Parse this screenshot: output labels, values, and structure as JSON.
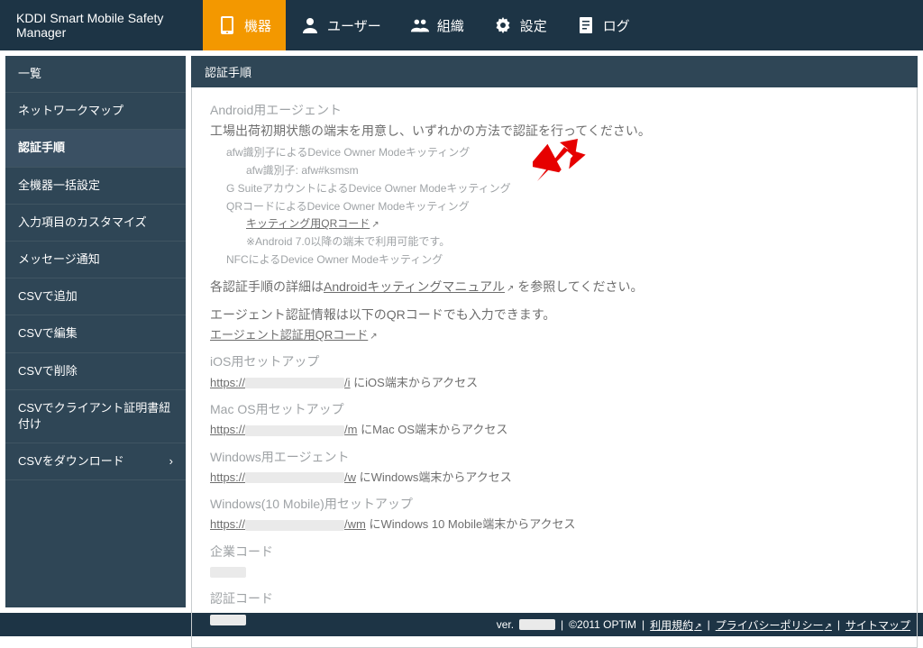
{
  "header": {
    "product_name": "KDDI Smart Mobile Safety Manager",
    "nav": {
      "devices": "機器",
      "users": "ユーザー",
      "orgs": "組織",
      "settings": "設定",
      "logs": "ログ"
    }
  },
  "sidebar": {
    "items": [
      "一覧",
      "ネットワークマップ",
      "認証手順",
      "全機器一括設定",
      "入力項目のカスタマイズ",
      "メッセージ通知",
      "CSVで追加",
      "CSVで編集",
      "CSVで削除",
      "CSVでクライアント証明書紐付け",
      "CSVをダウンロード"
    ],
    "active_index": 2
  },
  "panel": {
    "title": "認証手順",
    "android": {
      "heading": "Android用エージェント",
      "desc": "工場出荷初期状態の端末を用意し、いずれかの方法で認証を行ってください。",
      "afw_line": "afw識別子によるDevice Owner Modeキッティング",
      "afw_id_label": "afw識別子: afw#ksmsm",
      "gsuite_line": "G SuiteアカウントによるDevice Owner Modeキッティング",
      "qr_line": "QRコードによるDevice Owner Modeキッティング",
      "qr_link": "キッティング用QRコード",
      "qr_note": "※Android 7.0以降の端末で利用可能です。",
      "nfc_line": "NFCによるDevice Owner Modeキッティング",
      "summary_prefix": "各認証手順の詳細は",
      "summary_link": "Androidキッティングマニュアル",
      "summary_suffix": " を参照してください。",
      "agent_info_line": "エージェント認証情報は以下のQRコードでも入力できます。",
      "agent_qr_link": "エージェント認証用QRコード"
    },
    "platforms": {
      "ios_head": "iOS用セットアップ",
      "ios_url_prefix": "https://",
      "ios_url_suffix": "/i",
      "ios_note": " にiOS端末からアクセス",
      "mac_head": "Mac OS用セットアップ",
      "mac_url_prefix": "https://",
      "mac_url_suffix": "/m",
      "mac_note": " にMac OS端末からアクセス",
      "win_head": "Windows用エージェント",
      "win_url_prefix": "https://",
      "win_url_suffix": "/w",
      "win_note": " にWindows端末からアクセス",
      "win10m_head": "Windows(10 Mobile)用セットアップ",
      "win10m_url_prefix": "https://",
      "win10m_url_suffix": "/wm",
      "win10m_note": " にWindows 10 Mobile端末からアクセス"
    },
    "codes": {
      "company_label": "企業コード",
      "auth_label": "認証コード"
    }
  },
  "footer": {
    "ver_label": "ver.",
    "copyright": "©2011 OPTiM",
    "terms": "利用規約",
    "privacy": "プライバシーポリシー",
    "sitemap": "サイトマップ"
  }
}
